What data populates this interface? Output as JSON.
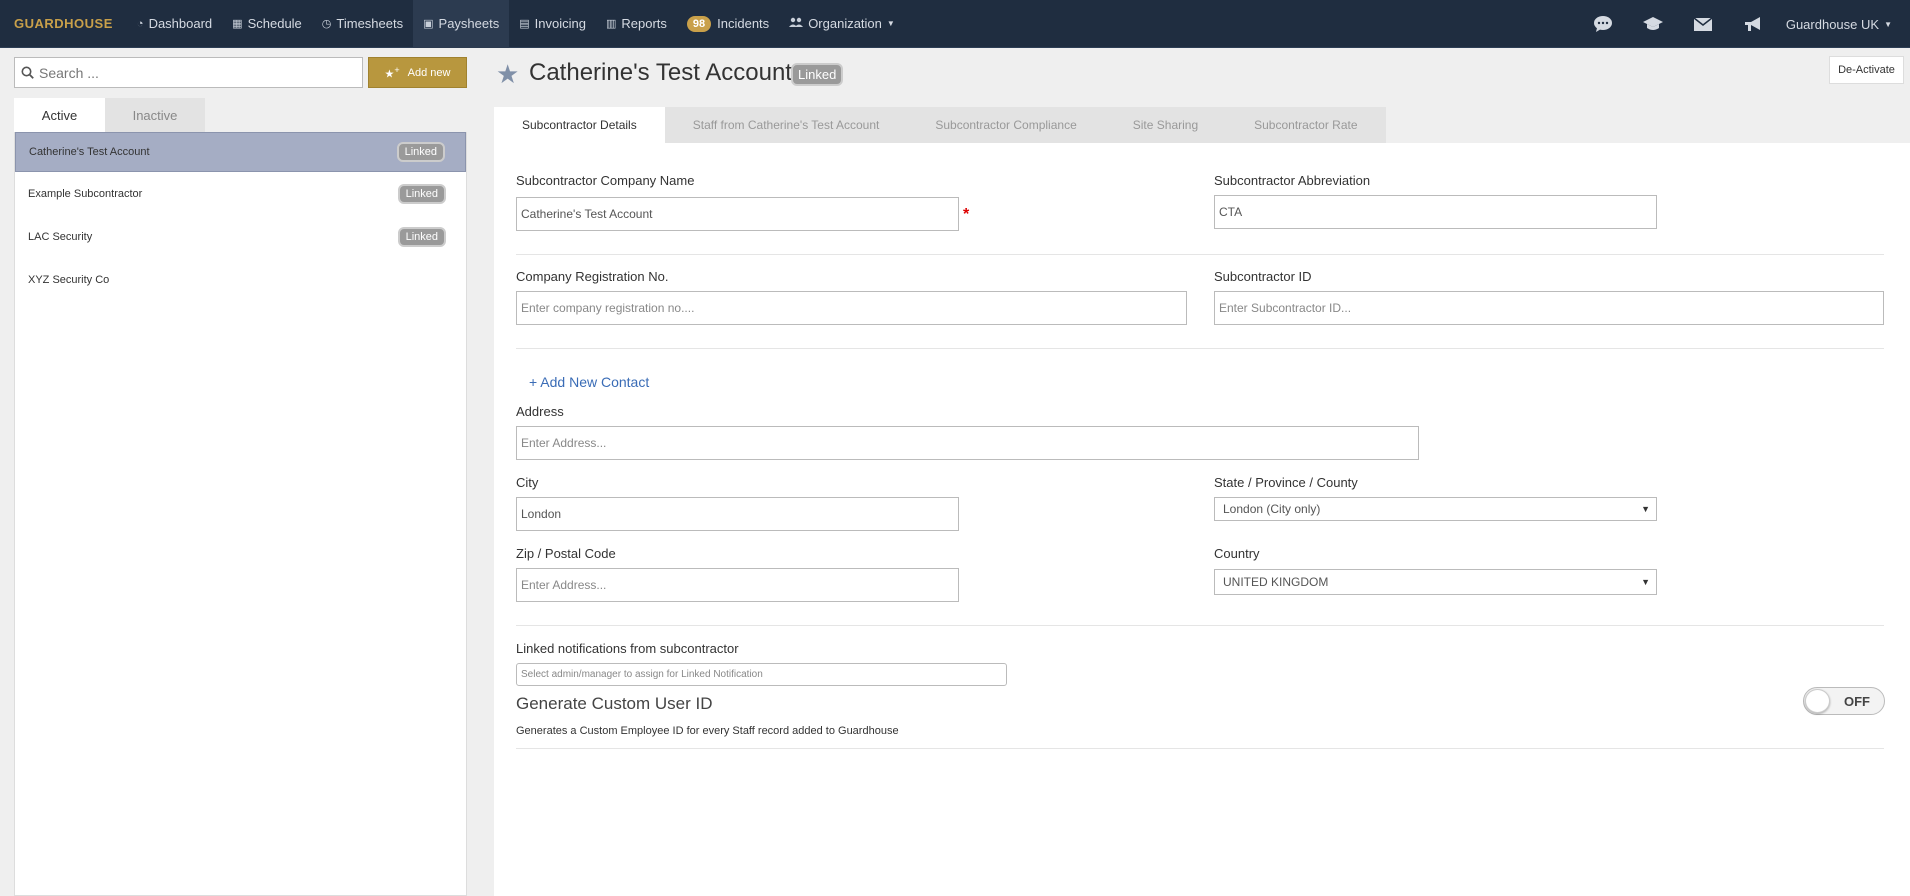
{
  "nav": {
    "brand": "GUARDHOUSE",
    "items": [
      {
        "label": "Dashboard",
        "icon": "dashboard-icon",
        "glyph": "◔"
      },
      {
        "label": "Schedule",
        "icon": "calendar-icon",
        "glyph": "▦"
      },
      {
        "label": "Timesheets",
        "icon": "clock-icon",
        "glyph": "◷"
      },
      {
        "label": "Paysheets",
        "icon": "money-icon",
        "glyph": "▣"
      },
      {
        "label": "Invoicing",
        "icon": "invoice-icon",
        "glyph": "▤"
      },
      {
        "label": "Reports",
        "icon": "table-icon",
        "glyph": "▥"
      },
      {
        "label": "Incidents",
        "icon": "incident-icon",
        "count": "98"
      },
      {
        "label": "Organization",
        "icon": "users-icon",
        "glyph": "👥"
      }
    ],
    "active": "Paysheets",
    "user": "Guardhouse UK"
  },
  "left": {
    "search_placeholder": "Search ...",
    "add_new": "Add new",
    "tabs": [
      "Active",
      "Inactive"
    ],
    "items": [
      {
        "name": "Catherine's Test Account",
        "badge": "Linked",
        "selected": true
      },
      {
        "name": "Example Subcontractor",
        "badge": "Linked"
      },
      {
        "name": "LAC Security",
        "badge": "Linked"
      },
      {
        "name": "XYZ Security Co",
        "badge": ""
      }
    ]
  },
  "header": {
    "title": "Catherine's Test Account",
    "badge": "Linked",
    "deactivate": "De-Activate"
  },
  "tabs": [
    "Subcontractor Details",
    "Staff from Catherine's Test Account",
    "Subcontractor Compliance",
    "Site Sharing",
    "Subcontractor Rate"
  ],
  "form": {
    "company_name_label": "Subcontractor Company Name",
    "company_name_value": "Catherine's Test Account",
    "abbreviation_label": "Subcontractor Abbreviation",
    "abbreviation_value": "CTA",
    "reg_label": "Company Registration No.",
    "reg_placeholder": "Enter company registration no....",
    "id_label": "Subcontractor ID",
    "id_placeholder": "Enter Subcontractor ID...",
    "add_contact": "+ Add New Contact",
    "address_label": "Address",
    "address_placeholder": "Enter Address...",
    "city_label": "City",
    "city_value": "London",
    "state_label": "State / Province / County",
    "state_value": "London (City only)",
    "zip_label": "Zip / Postal Code",
    "zip_placeholder": "Enter Address...",
    "country_label": "Country",
    "country_value": "UNITED KINGDOM",
    "linked_notif_label": "Linked notifications from subcontractor",
    "linked_notif_placeholder": "Select admin/manager to assign for Linked Notification",
    "custom_id_title": "Generate Custom User ID",
    "custom_id_desc": "Generates a Custom Employee ID for every Staff record added to Guardhouse",
    "toggle_state": "OFF"
  },
  "colors": {
    "nav_bg": "#1f2d40",
    "brand": "#c9a04a",
    "selected_row": "#a5adc4",
    "link": "#3a6cb6"
  }
}
